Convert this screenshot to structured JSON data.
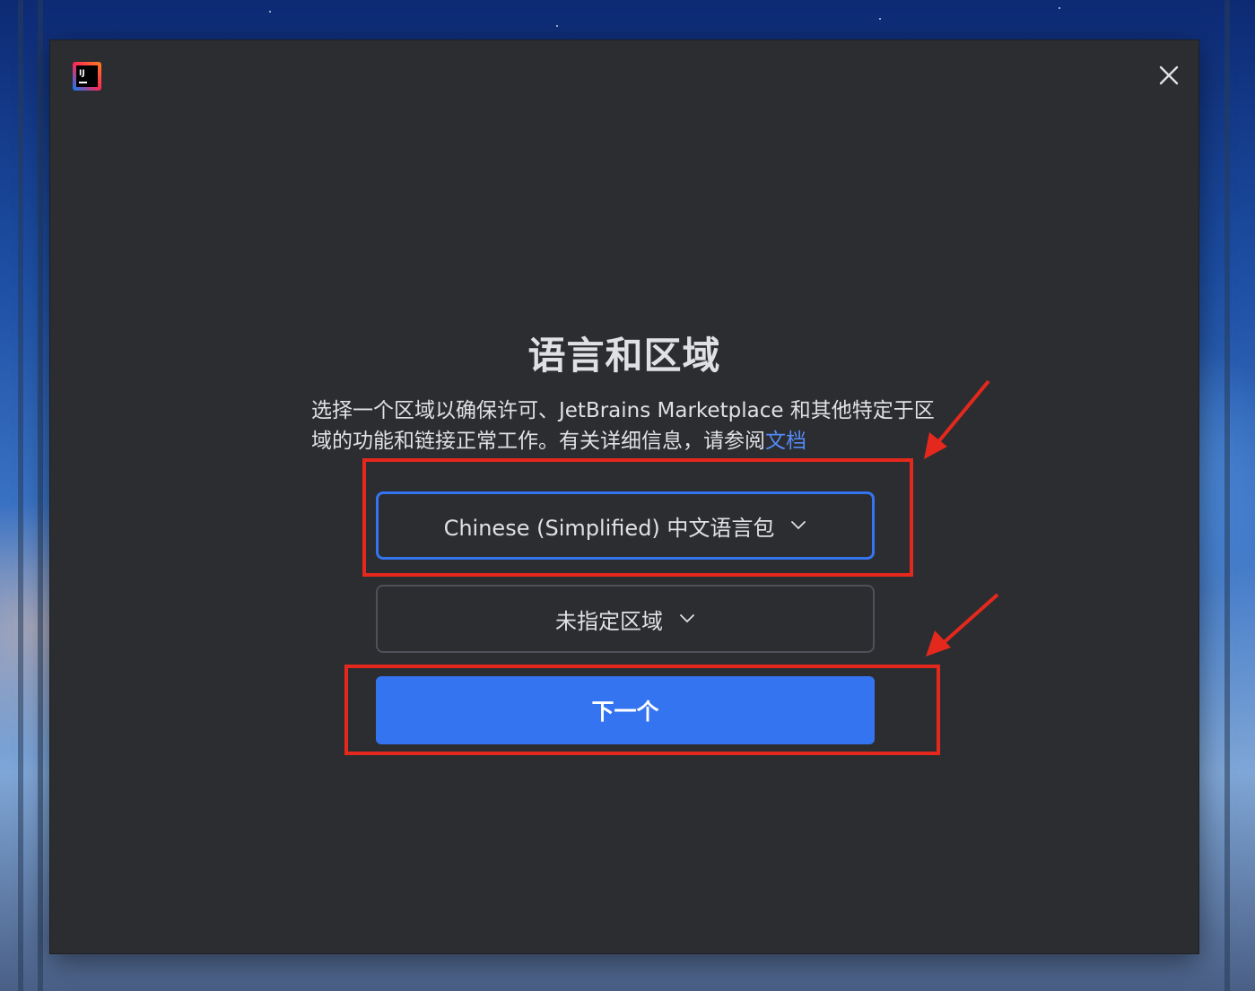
{
  "dialog": {
    "title": "语言和区域",
    "description_text": "选择一个区域以确保许可、JetBrains Marketplace 和其他特定于区域的功能和链接正常工作。有关详细信息，请参阅",
    "docs_link": "文档",
    "language_select": {
      "value": "Chinese (Simplified) 中文语言包"
    },
    "region_select": {
      "value": "未指定区域"
    },
    "next_button": "下一个",
    "logo_text": "IJ"
  },
  "colors": {
    "dialog_bg": "#2b2d30",
    "accent": "#3574f0",
    "link": "#548af7",
    "highlight_annotation": "#e5281e"
  },
  "icons": [
    "intellij-logo-icon",
    "close-icon",
    "chevron-down-icon"
  ]
}
